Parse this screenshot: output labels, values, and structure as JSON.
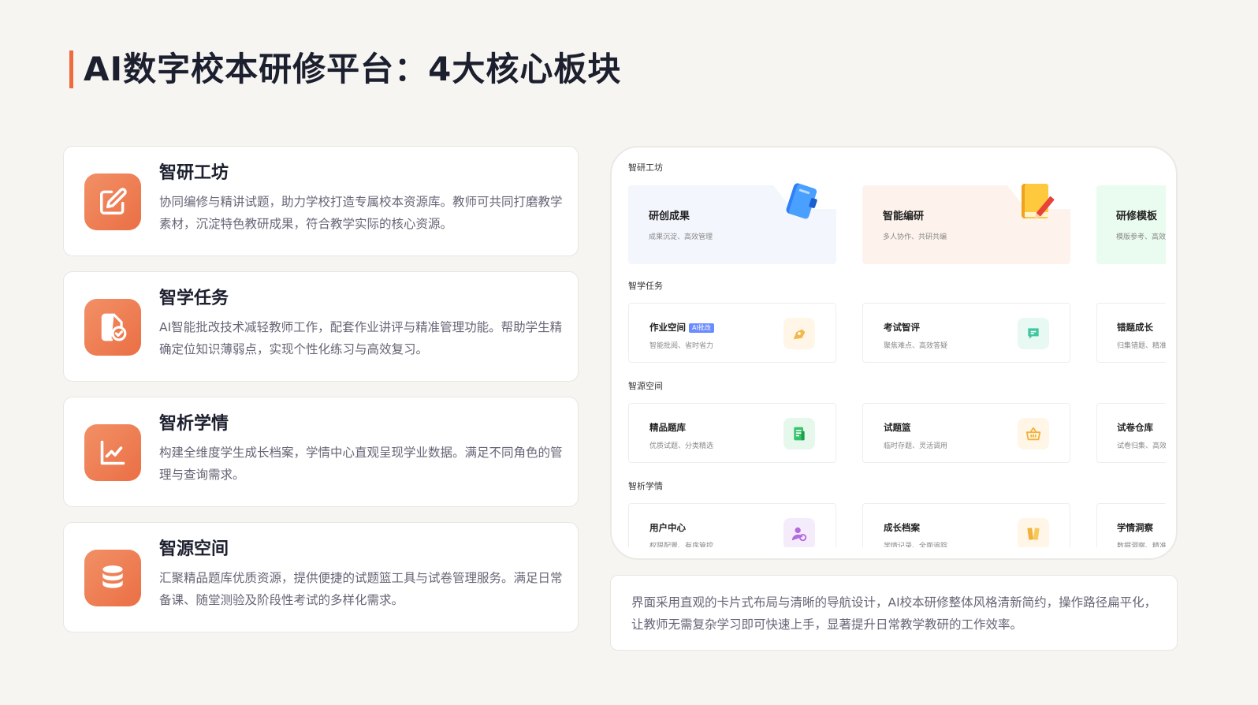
{
  "page": {
    "title": "AI数字校本研修平台：4大核心板块"
  },
  "features": [
    {
      "title": "智研工坊",
      "desc": "协同编修与精讲试题，助力学校打造专属校本资源库。教师可共同打磨教学素材，沉淀特色教研成果，符合教学实际的核心资源。",
      "icon": "edit-icon"
    },
    {
      "title": "智学任务",
      "desc": "AI智能批改技术减轻教师工作，配套作业讲评与精准管理功能。帮助学生精确定位知识薄弱点，实现个性化练习与高效复习。",
      "icon": "file-check-icon"
    },
    {
      "title": "智析学情",
      "desc": "构建全维度学生成长档案，学情中心直观呈现学业数据。满足不同角色的管理与查询需求。",
      "icon": "line-chart-icon"
    },
    {
      "title": "智源空间",
      "desc": "汇聚精品题库优质资源，提供便捷的试题篮工具与试卷管理服务。满足日常备课、随堂测验及阶段性考试的多样化需求。",
      "icon": "database-icon"
    }
  ],
  "mock": {
    "sections": [
      {
        "label": "智研工坊",
        "cards": [
          {
            "title": "研创成果",
            "sub": "成果沉淀、高效管理",
            "icon": "notebook-icon",
            "bg": "#f3f6fd"
          },
          {
            "title": "智能编研",
            "sub": "多人协作、共研共编",
            "icon": "book-pencil-icon",
            "bg": "#fdf3ec"
          },
          {
            "title": "研修模板",
            "sub": "模版参考、高效",
            "icon": "template-icon",
            "bg": "#eafcef"
          }
        ]
      },
      {
        "label": "智学任务",
        "cards": [
          {
            "title": "作业空间",
            "badge": "AI批改",
            "sub": "智能批阅、省时省力",
            "icon": "pen-nib-icon",
            "iconBg": "#fff6e8"
          },
          {
            "title": "考试智评",
            "sub": "聚焦难点、高效答疑",
            "icon": "message-icon",
            "iconBg": "#e8f8f3"
          },
          {
            "title": "错题成长",
            "sub": "归集错题、精准",
            "icon": "",
            "iconBg": ""
          }
        ]
      },
      {
        "label": "智源空间",
        "cards": [
          {
            "title": "精品题库",
            "sub": "优质试题、分类精选",
            "icon": "document-icon",
            "iconBg": "#e6f8ec"
          },
          {
            "title": "试题篮",
            "sub": "临时存题、灵活调用",
            "icon": "basket-icon",
            "iconBg": "#fff6e8"
          },
          {
            "title": "试卷仓库",
            "sub": "试卷归集、高效",
            "icon": "",
            "iconBg": ""
          }
        ]
      },
      {
        "label": "智析学情",
        "cards": [
          {
            "title": "用户中心",
            "sub": "权限配置、有序管控",
            "icon": "user-settings-icon",
            "iconBg": "#f5ecfb"
          },
          {
            "title": "成长档案",
            "sub": "学情记录、全面追踪",
            "icon": "folder-icon",
            "iconBg": "#fff6e8"
          },
          {
            "title": "学情洞察",
            "sub": "数据洞察、精准",
            "icon": "",
            "iconBg": ""
          }
        ]
      }
    ]
  },
  "note": {
    "text": "界面采用直观的卡片式布局与清晰的导航设计，AI校本研修整体风格清新简约，操作路径扁平化，让教师无需复杂学习即可快速上手，显著提升日常教学教研的工作效率。"
  },
  "colors": {
    "accent": "#ef6a3c",
    "title": "#1c1f2e",
    "body": "#667788"
  }
}
